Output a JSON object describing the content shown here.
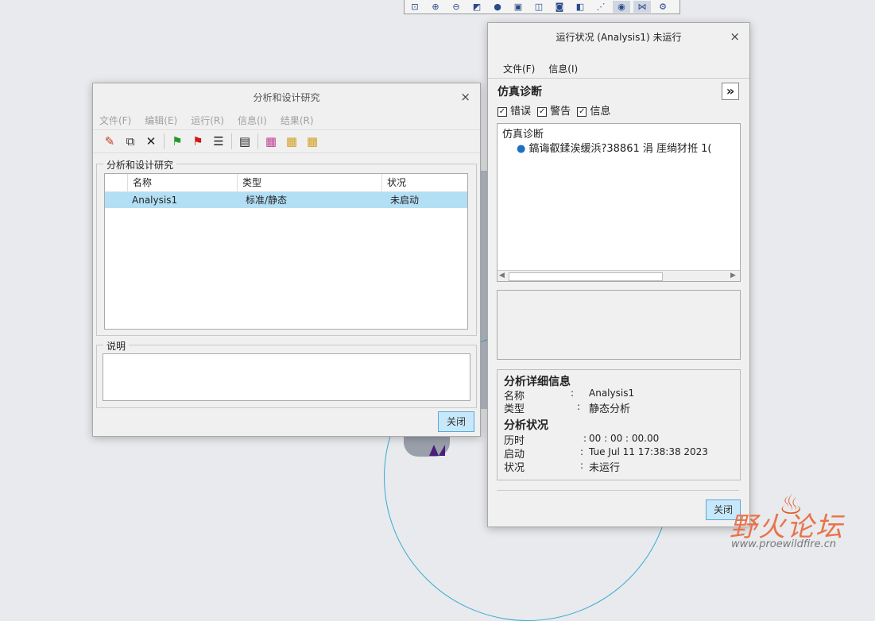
{
  "left_dialog": {
    "title": "分析和设计研究",
    "menu": [
      "文件(F)",
      "编辑(E)",
      "运行(R)",
      "信息(I)",
      "结果(R)"
    ],
    "group_label": "分析和设计研究",
    "columns": [
      "名称",
      "类型",
      "状况"
    ],
    "rows": [
      {
        "name": "Analysis1",
        "type": "标准/静态",
        "status": "未启动"
      }
    ],
    "desc_label": "说明",
    "close_button": "关闭"
  },
  "right_dialog": {
    "title": "运行状况 (Analysis1) 未运行",
    "menu": [
      "文件(F)",
      "信息(I)"
    ],
    "diag_title": "仿真诊断",
    "expand_glyph": "»",
    "filters": [
      {
        "label": "错误",
        "checked": true
      },
      {
        "label": "警告",
        "checked": true
      },
      {
        "label": "信息",
        "checked": true
      }
    ],
    "tree_root": "仿真诊断",
    "tree_item": "鎬诲叡鍒涘缓浜?38861 涓    厓绱犲拰 1(",
    "details_title": "分析详细信息",
    "name_key": "名称",
    "name_val": "Analysis1",
    "type_key": "类型",
    "type_val": "静态分析",
    "status_title": "分析状况",
    "elapsed_key": "历时",
    "elapsed_val": "00 : 00 : 00.00",
    "start_key": "启动",
    "start_val": "Tue Jul 11 17:38:38 2023",
    "state_key": "状况",
    "state_val": "未运行",
    "colon": ":",
    "close_button": "关闭"
  },
  "watermark": {
    "title": "野火论坛",
    "url": "www.proewildfire.cn"
  },
  "colors": {
    "selection": "#b3dff5",
    "button": "#c7e8fb",
    "accent_line": "#3aa9d6"
  }
}
